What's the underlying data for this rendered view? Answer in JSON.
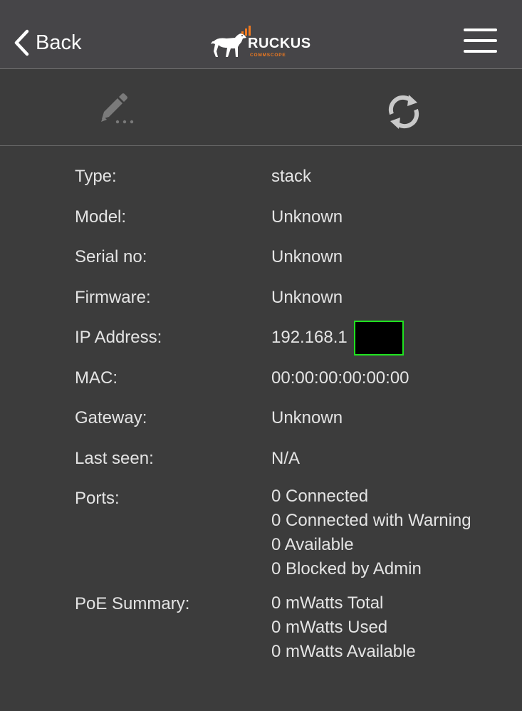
{
  "nav": {
    "back_label": "Back",
    "logo_text": "RUCKUS",
    "logo_subtext": "COMMSCOPE"
  },
  "icons": {
    "back": "chevron-left-icon",
    "menu": "hamburger-menu-icon",
    "edit": "pencil-icon",
    "refresh": "refresh-icon",
    "logo": "ruckus-dog-logo"
  },
  "colors": {
    "background": "#3c3c3c",
    "navbar": "#464548",
    "brand_orange": "#f07a20",
    "redaction_border": "#1fe21f"
  },
  "details": {
    "type": {
      "label": "Type:",
      "value": "stack"
    },
    "model": {
      "label": "Model:",
      "value": "Unknown"
    },
    "serial": {
      "label": "Serial no:",
      "value": "Unknown"
    },
    "firmware": {
      "label": "Firmware:",
      "value": "Unknown"
    },
    "ip": {
      "label": "IP Address:",
      "value": "192.168.1"
    },
    "mac": {
      "label": "MAC:",
      "value": "00:00:00:00:00:00"
    },
    "gateway": {
      "label": "Gateway:",
      "value": "Unknown"
    },
    "last_seen": {
      "label": "Last seen:",
      "value": "N/A"
    },
    "ports": {
      "label": "Ports:",
      "lines": [
        "0 Connected",
        "0 Connected with Warning",
        "0 Available",
        "0 Blocked by Admin"
      ]
    },
    "poe": {
      "label": "PoE Summary:",
      "lines": [
        "0 mWatts Total",
        "0 mWatts Used",
        "0 mWatts Available"
      ]
    }
  }
}
